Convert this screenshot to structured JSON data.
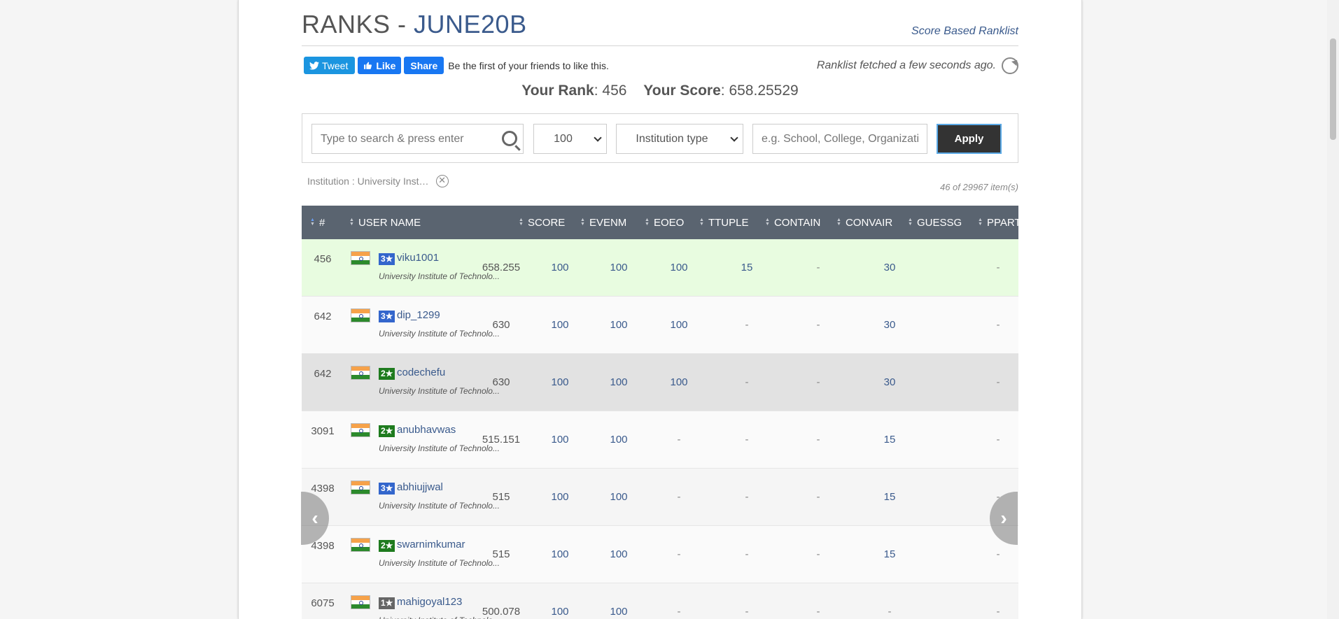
{
  "header": {
    "title_prefix": "RANKS - ",
    "contest_code": "JUNE20B",
    "score_based_link": "Score Based Ranklist"
  },
  "social": {
    "tweet_label": "Tweet",
    "like_label": "Like",
    "share_label": "Share",
    "fb_text": "Be the first of your friends to like this."
  },
  "fetched_text": "Ranklist fetched a few seconds ago.",
  "summary": {
    "rank_label": "Your Rank",
    "rank_value": "456",
    "score_label": "Your Score",
    "score_value": "658.25529"
  },
  "filters": {
    "search_placeholder": "Type to search & press enter",
    "count_value": "100",
    "institution_type": "Institution type",
    "institution_placeholder": "e.g. School, College, Organizati",
    "apply_label": "Apply",
    "chip_text": "Institution : University Inst…",
    "chip_close": "✕",
    "items_count": "46 of 29967 item(s)"
  },
  "table": {
    "columns": [
      "#",
      "USER NAME",
      "SCORE",
      "EVENM",
      "EOEO",
      "TTUPLE",
      "CONTAIN",
      "CONVAIR",
      "GUESSG",
      "PPART"
    ],
    "rows": [
      {
        "rank": "456",
        "stars": "3★",
        "star_color": "#3366cc",
        "user": "viku1001",
        "institution": "University Institute of Technolo...",
        "score": "658.255",
        "evenm": "100",
        "eoeo": "100",
        "ttuple": "100",
        "contain": "15",
        "convair": "-",
        "guessg": "30",
        "ppart": "-",
        "bg": "#e8fce0"
      },
      {
        "rank": "642",
        "stars": "3★",
        "star_color": "#3366cc",
        "user": "dip_1299",
        "institution": "University Institute of Technolo...",
        "score": "630",
        "evenm": "100",
        "eoeo": "100",
        "ttuple": "100",
        "contain": "-",
        "convair": "-",
        "guessg": "30",
        "ppart": "-",
        "bg": "#fafafa"
      },
      {
        "rank": "642",
        "stars": "2★",
        "star_color": "#1e7b1e",
        "user": "codechefu",
        "institution": "University Institute of Technolo...",
        "score": "630",
        "evenm": "100",
        "eoeo": "100",
        "ttuple": "100",
        "contain": "-",
        "convair": "-",
        "guessg": "30",
        "ppart": "-",
        "bg": "#e2e2e2"
      },
      {
        "rank": "3091",
        "stars": "2★",
        "star_color": "#1e7b1e",
        "user": "anubhavwas",
        "institution": "University Institute of Technolo...",
        "score": "515.151",
        "evenm": "100",
        "eoeo": "100",
        "ttuple": "-",
        "contain": "-",
        "convair": "-",
        "guessg": "15",
        "ppart": "-",
        "bg": "#fafafa"
      },
      {
        "rank": "4398",
        "stars": "3★",
        "star_color": "#3366cc",
        "user": "abhiujjwal",
        "institution": "University Institute of Technolo...",
        "score": "515",
        "evenm": "100",
        "eoeo": "100",
        "ttuple": "-",
        "contain": "-",
        "convair": "-",
        "guessg": "15",
        "ppart": "-",
        "bg": "#f5f5f5"
      },
      {
        "rank": "4398",
        "stars": "2★",
        "star_color": "#1e7b1e",
        "user": "swarnimkumar",
        "institution": "University Institute of Technolo...",
        "score": "515",
        "evenm": "100",
        "eoeo": "100",
        "ttuple": "-",
        "contain": "-",
        "convair": "-",
        "guessg": "15",
        "ppart": "-",
        "bg": "#fafafa"
      },
      {
        "rank": "6075",
        "stars": "1★",
        "star_color": "#666666",
        "user": "mahigoyal123",
        "institution": "University Institute of Technolo...",
        "score": "500.078",
        "evenm": "100",
        "eoeo": "100",
        "ttuple": "-",
        "contain": "-",
        "convair": "-",
        "guessg": "-",
        "ppart": "-",
        "bg": "#f5f5f5"
      }
    ]
  },
  "nav": {
    "prev_glyph": "‹",
    "next_glyph": "›"
  }
}
